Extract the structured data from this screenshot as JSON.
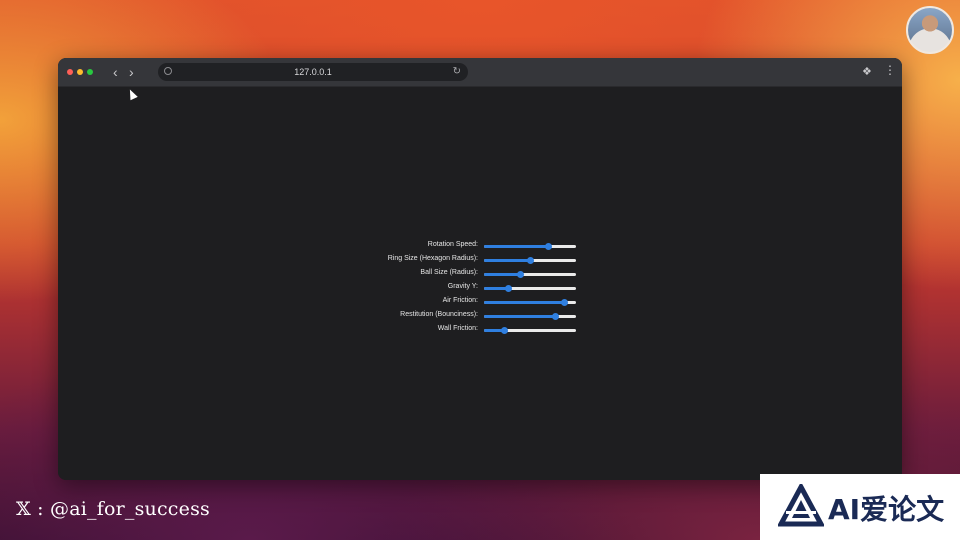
{
  "browser": {
    "url": "127.0.0.1",
    "nav_back_icon": "chevron-left-icon",
    "nav_forward_icon": "chevron-right-icon",
    "reload_icon": "reload-icon",
    "extensions_icon": "puzzle-icon",
    "menu_icon": "kebab-menu-icon"
  },
  "controls": [
    {
      "label": "Rotation Speed:",
      "value": 0.7
    },
    {
      "label": "Ring Size (Hexagon Radius):",
      "value": 0.5
    },
    {
      "label": "Ball Size (Radius):",
      "value": 0.4
    },
    {
      "label": "Gravity Y:",
      "value": 0.27
    },
    {
      "label": "Air Friction:",
      "value": 0.87
    },
    {
      "label": "Restitution (Bounciness):",
      "value": 0.78
    },
    {
      "label": "Wall Friction:",
      "value": 0.22
    }
  ],
  "watermark": {
    "text": "𝕏 : @ai_for_success"
  },
  "badge": {
    "text": "AI爱论文"
  },
  "colors": {
    "accent": "#2f7fe0",
    "window_bg": "#1f1f22",
    "toolbar_bg": "#35363a"
  }
}
